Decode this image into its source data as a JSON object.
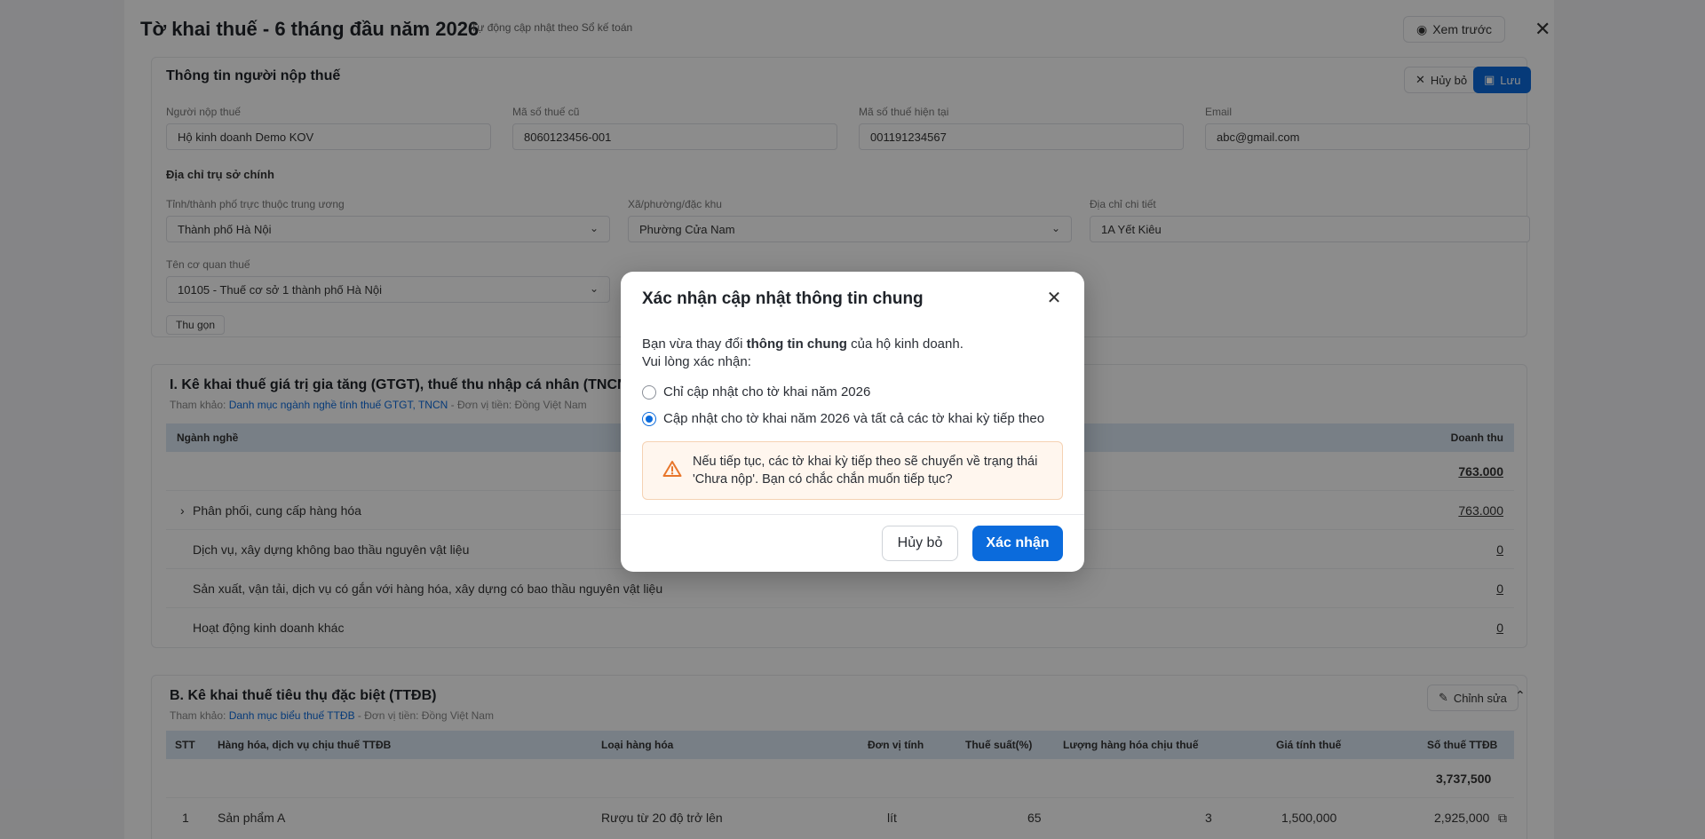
{
  "background": {
    "title": "Tờ khai thuế - 6 tháng đầu năm 2026",
    "subtitle": "Tự động cập nhật theo Sổ kế toán",
    "preview_label": "Xem trước",
    "taxpayer_section": {
      "title": "Thông tin người nộp thuế",
      "cancel_label": "Hủy bỏ",
      "save_label": "Lưu",
      "fields": [
        {
          "label": "Người nộp thuế",
          "value": "Hộ kinh doanh Demo KOV"
        },
        {
          "label": "Mã số thuế cũ",
          "value": "8060123456-001"
        },
        {
          "label": "Mã số thuế hiện tại",
          "value": "001191234567"
        },
        {
          "label": "Email",
          "value": "abc@gmail.com"
        }
      ],
      "address_head": "Địa chỉ trụ sở chính",
      "province_label": "Tỉnh/thành phố trực thuộc trung ương",
      "province_value": "Thành phố Hà Nội",
      "ward_label": "Xã/phường/đặc khu",
      "ward_value": "Phường Cửa Nam",
      "detail_label": "Địa chỉ chi tiết",
      "detail_value": "1A Yết Kiêu",
      "office_label": "Tên cơ quan thuế",
      "office_value": "10105 - Thuế cơ sở 1 thành phố Hà Nội",
      "collapse_label": "Thu gọn"
    },
    "section1": {
      "title": "I. Kê khai thuế giá trị gia tăng (GTGT), thuế thu nhập cá nhân (TNCN)",
      "ref_prefix": "Tham khảo:",
      "ref_link": "Danh mục ngành nghề tính thuế GTGT, TNCN",
      "ref_suffix": "- Đơn vị tiền: Đồng Việt Nam",
      "col_industry": "Ngành nghề",
      "col_revenue": "Doanh thu",
      "total": "763.000",
      "rows": [
        {
          "name": "Phân phối, cung cấp hàng hóa",
          "value": "763.000"
        },
        {
          "name": "Dịch vụ, xây dựng không bao thầu nguyên vật liệu",
          "value": "0"
        },
        {
          "name": "Sản xuất, vận tải, dịch vụ có gắn với hàng hóa, xây dựng có bao thầu nguyên vật liệu",
          "value": "0"
        },
        {
          "name": "Hoạt động kinh doanh khác",
          "value": "0"
        }
      ]
    },
    "section2": {
      "title": "B. Kê khai thuế tiêu thụ đặc biệt (TTĐB)",
      "ref_prefix": "Tham khảo:",
      "ref_link": "Danh mục biểu thuế TTĐB",
      "ref_suffix": "- Đơn vị tiền: Đồng Việt Nam",
      "edit_label": "Chỉnh sửa",
      "columns": [
        "STT",
        "Hàng hóa, dịch vụ chịu thuế TTĐB",
        "Loại hàng hóa",
        "Đơn vị tính",
        "Thuế suất(%)",
        "Lượng hàng hóa chịu thuế",
        "Giá tính thuế",
        "Số thuế TTĐB"
      ],
      "total": "3,737,500",
      "row": [
        "1",
        "Sản phẩm A",
        "Rượu từ 20 độ trở lên",
        "lít",
        "65",
        "3",
        "1,500,000",
        "2,925,000"
      ]
    }
  },
  "modal": {
    "title": "Xác nhận cập nhật thông tin chung",
    "body_prefix": "Bạn vừa thay đổi ",
    "body_bold": "thông tin chung",
    "body_suffix": " của hộ kinh doanh.",
    "body_line2": "Vui lòng xác nhận:",
    "option1": "Chỉ cập nhật cho tờ khai năm 2026",
    "option2": "Cập nhật cho tờ khai năm 2026 và tất cả các tờ khai kỳ tiếp theo",
    "selected_option": 2,
    "warning": "Nếu tiếp tục, các tờ khai kỳ tiếp theo sẽ chuyển về trạng thái 'Chưa nộp'. Bạn có chắc chắn muốn tiếp tục?",
    "cancel_label": "Hủy bỏ",
    "confirm_label": "Xác nhận"
  },
  "colors": {
    "primary": "#0b6bdc",
    "warning_bg": "#fff6ee",
    "warning_icon": "#e8762b"
  }
}
